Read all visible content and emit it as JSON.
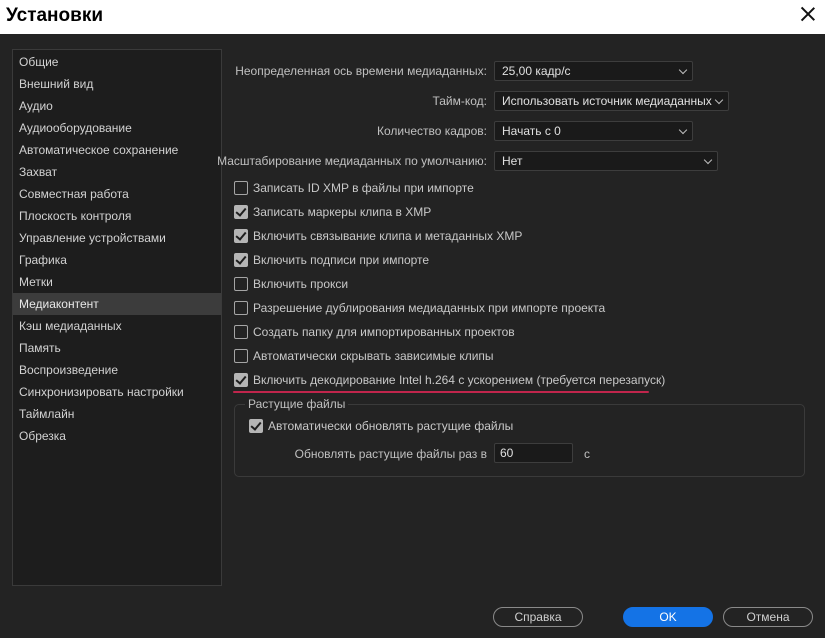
{
  "window": {
    "title": "Установки"
  },
  "sidebar": {
    "items": [
      "Общие",
      "Внешний вид",
      "Аудио",
      "Аудиооборудование",
      "Автоматическое сохранение",
      "Захват",
      "Совместная работа",
      "Плоскость контроля",
      "Управление устройствами",
      "Графика",
      "Метки",
      "Медиаконтент",
      "Кэш медиаданных",
      "Память",
      "Воспроизведение",
      "Синхронизировать настройки",
      "Таймлайн",
      "Обрезка"
    ],
    "selected": "Медиаконтент"
  },
  "settings": {
    "timebase": {
      "label": "Неопределенная ось времени медиаданных:",
      "value": "25,00 кадр/с"
    },
    "timecode": {
      "label": "Тайм-код:",
      "value": "Использовать источник медиаданных"
    },
    "frame_count": {
      "label": "Количество кадров:",
      "value": "Начать с 0"
    },
    "default_scale": {
      "label": "Масштабирование медиаданных по умолчанию:",
      "value": "Нет"
    }
  },
  "checkboxes": [
    {
      "label": "Записать ID XMP в файлы при импорте",
      "checked": false
    },
    {
      "label": "Записать маркеры клипа в XMP",
      "checked": true
    },
    {
      "label": "Включить связывание клипа и метаданных XMP",
      "checked": true
    },
    {
      "label": "Включить подписи при импорте",
      "checked": true
    },
    {
      "label": "Включить прокси",
      "checked": false
    },
    {
      "label": "Разрешение дублирования медиаданных при импорте проекта",
      "checked": false
    },
    {
      "label": "Создать папку для импортированных проектов",
      "checked": false
    },
    {
      "label": "Автоматически скрывать зависимые клипы",
      "checked": false
    },
    {
      "label": "Включить декодирование Intel h.264 с ускорением (требуется перезапуск)",
      "checked": true
    }
  ],
  "growing_files": {
    "legend": "Растущие файлы",
    "auto_refresh": {
      "label": "Автоматически обновлять растущие файлы",
      "checked": true
    },
    "refresh_interval": {
      "label": "Обновлять растущие файлы раз в",
      "value": "60",
      "unit": "с"
    }
  },
  "buttons": {
    "help": "Справка",
    "ok": "OK",
    "cancel": "Отмена"
  },
  "colors": {
    "accent": "#1473e6",
    "highlight_line": "#c0254c"
  }
}
